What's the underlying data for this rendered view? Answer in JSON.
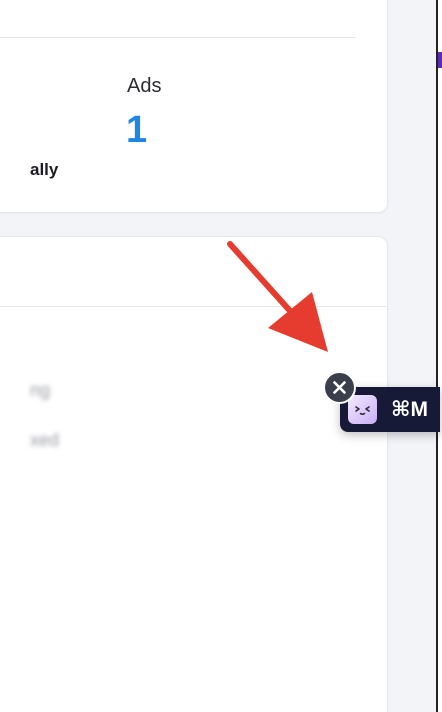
{
  "stats": {
    "ads_label": "Ads",
    "ads_value": "1"
  },
  "content": {
    "fragment_bold": "ally",
    "blurred_line_1": "ng",
    "blurred_line_2": "xed"
  },
  "widget": {
    "shortcut": "⌘M",
    "icon": "assistant-face-icon",
    "close_icon": "close-icon"
  },
  "colors": {
    "accent_blue": "#1e87e5",
    "widget_bg": "#171a36",
    "arrow_red": "#e63c2f",
    "rail_accent": "#5b2bb5"
  }
}
